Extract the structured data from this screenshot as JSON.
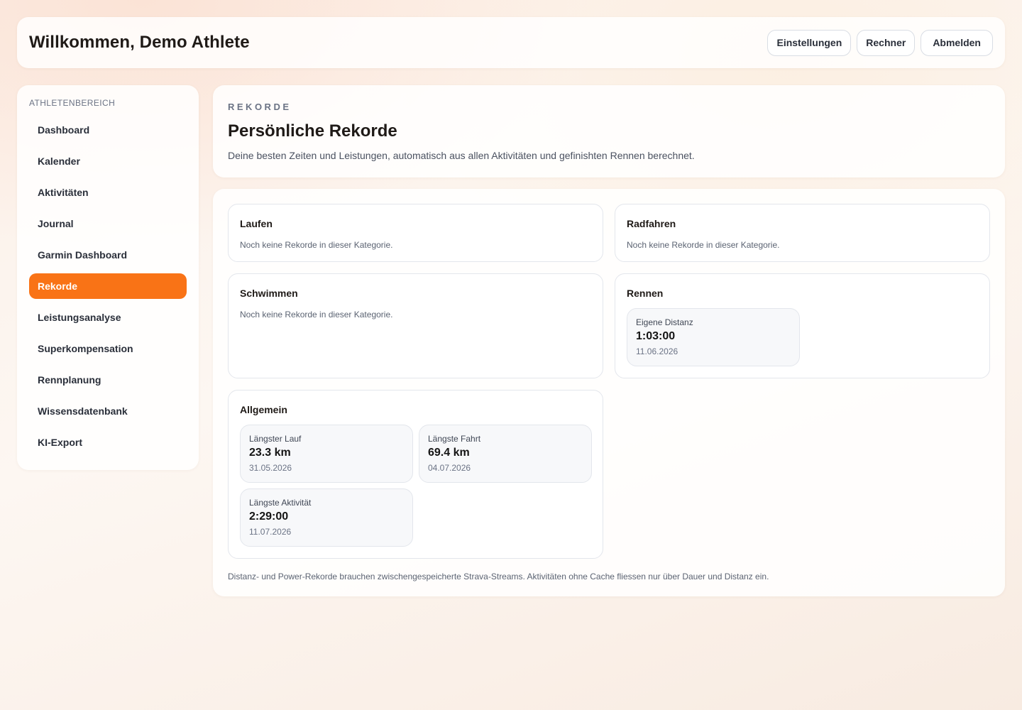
{
  "header": {
    "title": "Willkommen, Demo Athlete",
    "buttons": {
      "settings": "Einstellungen",
      "calculator": "Rechner",
      "logout": "Abmelden"
    }
  },
  "sidebar": {
    "heading": "ATHLETENBEREICH",
    "items": [
      {
        "label": "Dashboard",
        "active": false
      },
      {
        "label": "Kalender",
        "active": false
      },
      {
        "label": "Aktivitäten",
        "active": false
      },
      {
        "label": "Journal",
        "active": false
      },
      {
        "label": "Garmin Dashboard",
        "active": false
      },
      {
        "label": "Rekorde",
        "active": true
      },
      {
        "label": "Leistungsanalyse",
        "active": false
      },
      {
        "label": "Superkompensation",
        "active": false
      },
      {
        "label": "Rennplanung",
        "active": false
      },
      {
        "label": "Wissensdatenbank",
        "active": false
      },
      {
        "label": "KI-Export",
        "active": false
      }
    ]
  },
  "page": {
    "eyebrow": "REKORDE",
    "title": "Persönliche Rekorde",
    "description": "Deine besten Zeiten und Leistungen, automatisch aus allen Aktivitäten und gefinishten Rennen berechnet."
  },
  "categories": {
    "running": {
      "title": "Laufen",
      "empty": "Noch keine Rekorde in dieser Kategorie."
    },
    "cycling": {
      "title": "Radfahren",
      "empty": "Noch keine Rekorde in dieser Kategorie."
    },
    "swimming": {
      "title": "Schwimmen",
      "empty": "Noch keine Rekorde in dieser Kategorie."
    },
    "races": {
      "title": "Rennen",
      "records": [
        {
          "label": "Eigene Distanz",
          "value": "1:03:00",
          "date": "11.06.2026"
        }
      ]
    },
    "general": {
      "title": "Allgemein",
      "records": [
        {
          "label": "Längster Lauf",
          "value": "23.3 km",
          "date": "31.05.2026"
        },
        {
          "label": "Längste Fahrt",
          "value": "69.4 km",
          "date": "04.07.2026"
        },
        {
          "label": "Längste Aktivität",
          "value": "2:29:00",
          "date": "11.07.2026"
        }
      ]
    }
  },
  "footnote": "Distanz- und Power-Rekorde brauchen zwischengespeicherte Strava-Streams. Aktivitäten ohne Cache fliessen nur über Dauer und Distanz ein.",
  "colors": {
    "accent": "#f97316"
  }
}
